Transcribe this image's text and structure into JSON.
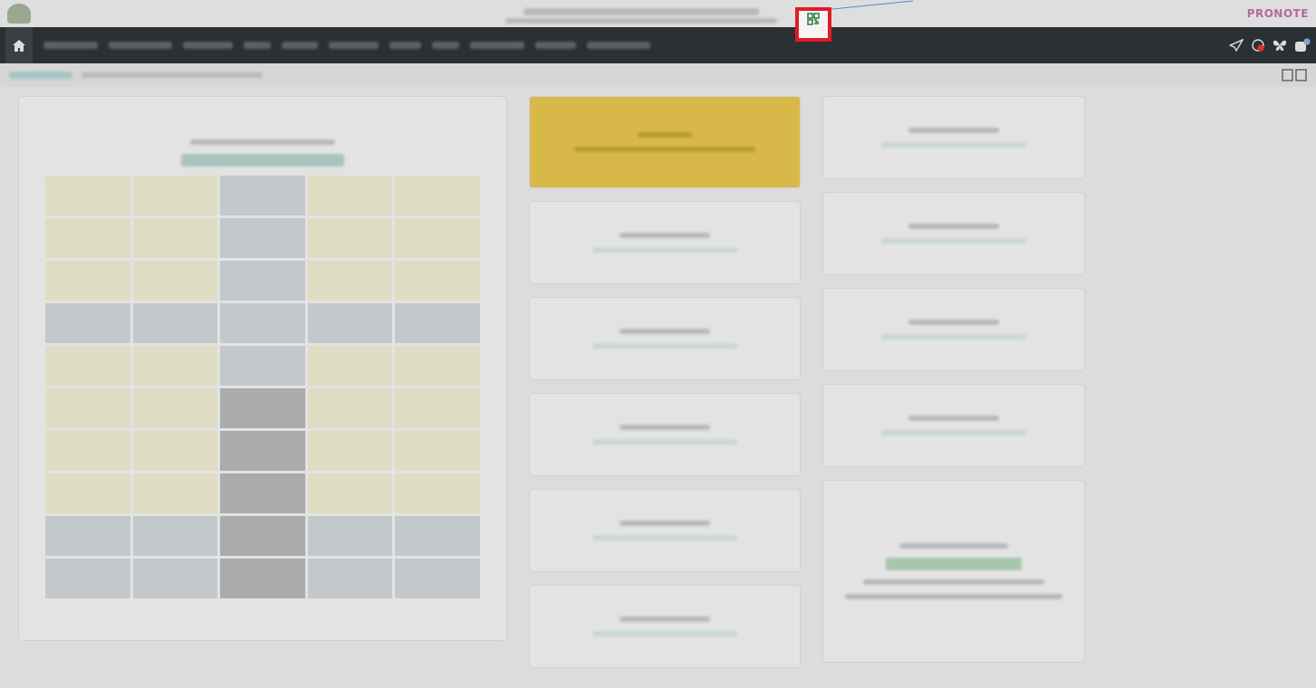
{
  "header": {
    "brand": "PRONOTE",
    "qr_highlighted": true
  },
  "columns": [
    {
      "panels": [
        {
          "kind": "timetable"
        }
      ]
    },
    {
      "panels": [
        {
          "kind": "alert"
        },
        {
          "kind": "card"
        },
        {
          "kind": "card"
        },
        {
          "kind": "card"
        },
        {
          "kind": "card"
        },
        {
          "kind": "card"
        }
      ]
    },
    {
      "panels": [
        {
          "kind": "card"
        },
        {
          "kind": "card"
        },
        {
          "kind": "card"
        },
        {
          "kind": "card"
        },
        {
          "kind": "list"
        }
      ]
    }
  ]
}
